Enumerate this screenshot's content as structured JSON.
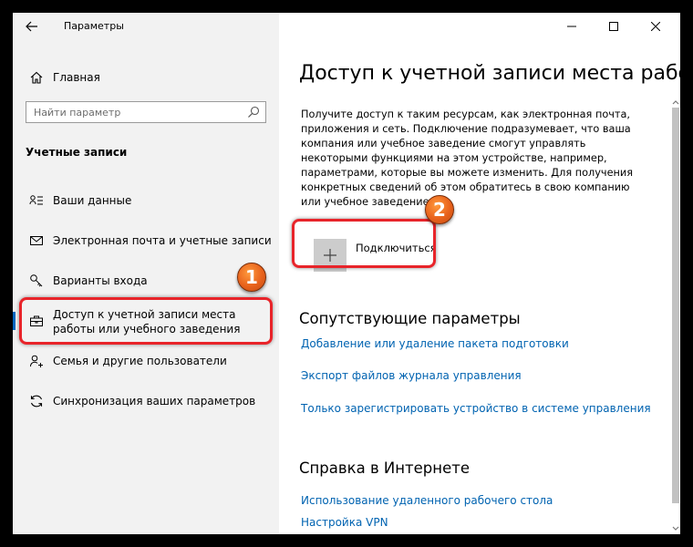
{
  "window": {
    "title": "Параметры",
    "controls": {
      "minimize": "minimize",
      "maximize": "maximize",
      "close": "close"
    }
  },
  "sidebar": {
    "home_label": "Главная",
    "search_placeholder": "Найти параметр",
    "section_title": "Учетные записи",
    "items": [
      {
        "label": "Ваши данные",
        "icon": "person-card-icon"
      },
      {
        "label": "Электронная почта и учетные записи",
        "icon": "mail-icon"
      },
      {
        "label": "Варианты входа",
        "icon": "key-icon"
      },
      {
        "label": "Доступ к учетной записи места работы или учебного заведения",
        "icon": "briefcase-icon",
        "active": true
      },
      {
        "label": "Семья и другие пользователи",
        "icon": "person-add-icon"
      },
      {
        "label": "Синхронизация ваших параметров",
        "icon": "sync-icon"
      }
    ]
  },
  "main": {
    "title": "Доступ к учетной записи места работы или учебного заведения",
    "description": "Получите доступ к таким ресурсам, как электронная почта, приложения и сеть. Подключение подразумевает, что ваша компания или учебное заведение смогут управлять некоторыми функциями на этом устройстве, например, параметрами, которые вы можете изменить. Для получения конкретных сведений об этом обратитесь в свою компанию или учебное заведение.",
    "connect_label": "Подключиться",
    "related_title": "Сопутствующие параметры",
    "related_links": [
      "Добавление или удаление пакета подготовки",
      "Экспорт файлов журнала управления",
      "Только зарегистрировать устройство в системе управления"
    ],
    "help_title": "Справка в Интернете",
    "help_links": [
      "Использование удаленного рабочего стола",
      "Настройка VPN"
    ]
  },
  "annotations": [
    {
      "number": "1"
    },
    {
      "number": "2"
    }
  ],
  "colors": {
    "accent": "#0067c0",
    "link": "#0063b1",
    "annotation_red": "#e8242a",
    "annotation_orange": "#e8621c"
  }
}
